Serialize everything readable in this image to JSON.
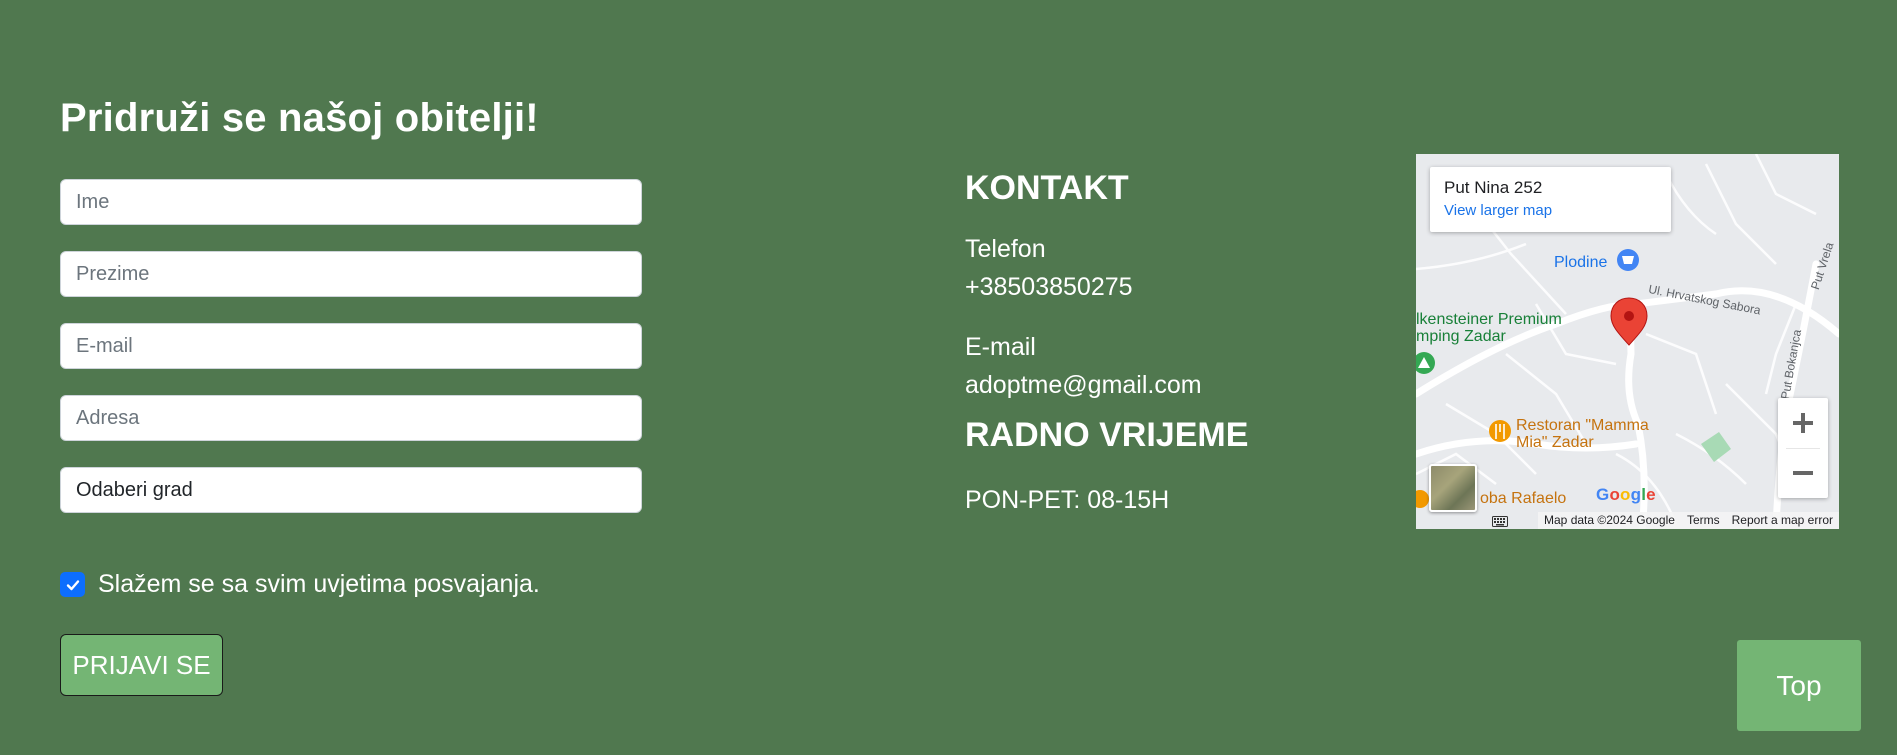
{
  "form": {
    "title": "Pridruži se našoj obitelji!",
    "fields": {
      "first_name_placeholder": "Ime",
      "last_name_placeholder": "Prezime",
      "email_placeholder": "E-mail",
      "address_placeholder": "Adresa"
    },
    "city_select": {
      "selected": "Odaberi grad"
    },
    "terms": {
      "checked": true,
      "label": "Slažem se sa svim uvjetima posvajanja."
    },
    "submit_label": "PRIJAVI SE"
  },
  "contact": {
    "heading": "KONTAKT",
    "phone_label": "Telefon",
    "phone_value": "+38503850275",
    "email_label": "E-mail",
    "email_value": "adoptme@gmail.com",
    "hours_heading": "RADNO VRIJEME",
    "hours_value": "PON-PET: 08-15H"
  },
  "map": {
    "card_title": "Put Nina 252",
    "card_link": "View larger map",
    "places": {
      "plodine": "Plodine",
      "camping_line1": "lkensteiner Premium",
      "camping_line2": "mping Zadar",
      "restoran_line1": "Restoran \"Mamma",
      "restoran_line2": "Mia\" Zadar",
      "rafaelo": "oba Rafaelo"
    },
    "roads": {
      "hrvatskog_sabora": "Ul. Hrvatskog Sabora",
      "put_vrela": "Put Vrela",
      "put_bokanjca": "Put Bokanjca"
    },
    "attribution": {
      "map_data": "Map data ©2024 Google",
      "terms": "Terms",
      "report": "Report a map error"
    },
    "logo": "Google",
    "zoom_in_icon": "plus-icon",
    "zoom_out_icon": "minus-icon",
    "colors": {
      "marker": "#ea4335",
      "link": "#1a73e8"
    }
  },
  "top_button_label": "Top",
  "colors": {
    "background": "#50784f",
    "button": "#74b574",
    "checkbox": "#0d6efd"
  }
}
